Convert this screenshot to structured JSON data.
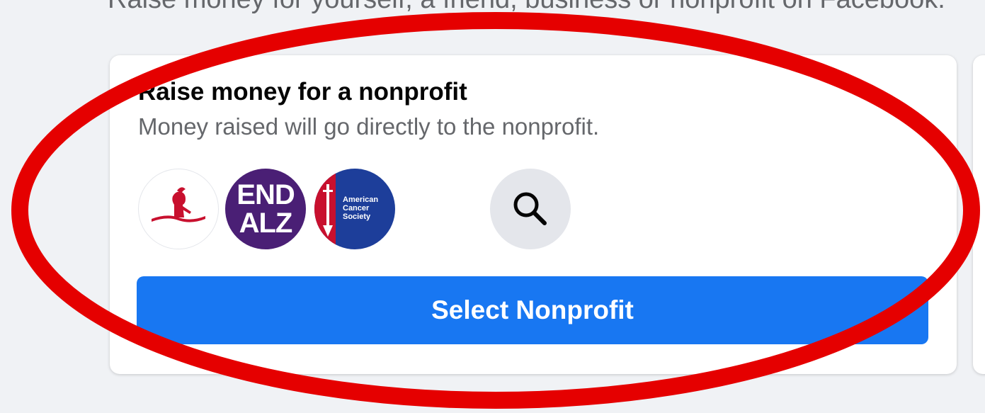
{
  "header": {
    "subtitle": "Raise money for yourself, a friend, business or nonprofit on Facebook."
  },
  "nonprofit_card": {
    "title": "Raise money for a nonprofit",
    "description": "Money raised will go directly to the nonprofit.",
    "logos": [
      {
        "name": "st-jude-logo"
      },
      {
        "name": "endalz-logo",
        "text_line1": "END",
        "text_line2": "ALZ"
      },
      {
        "name": "american-cancer-society-logo",
        "text": "American Cancer Society"
      }
    ],
    "search_icon": "search-icon",
    "button_label": "Select Nonprofit"
  },
  "colors": {
    "primary": "#1877f2",
    "background": "#f0f2f5",
    "annotation": "#e50000",
    "endalz_purple": "#4a1f75",
    "acs_blue": "#1d3e9a",
    "acs_red": "#c8102e",
    "stjude_red": "#c8102e"
  }
}
